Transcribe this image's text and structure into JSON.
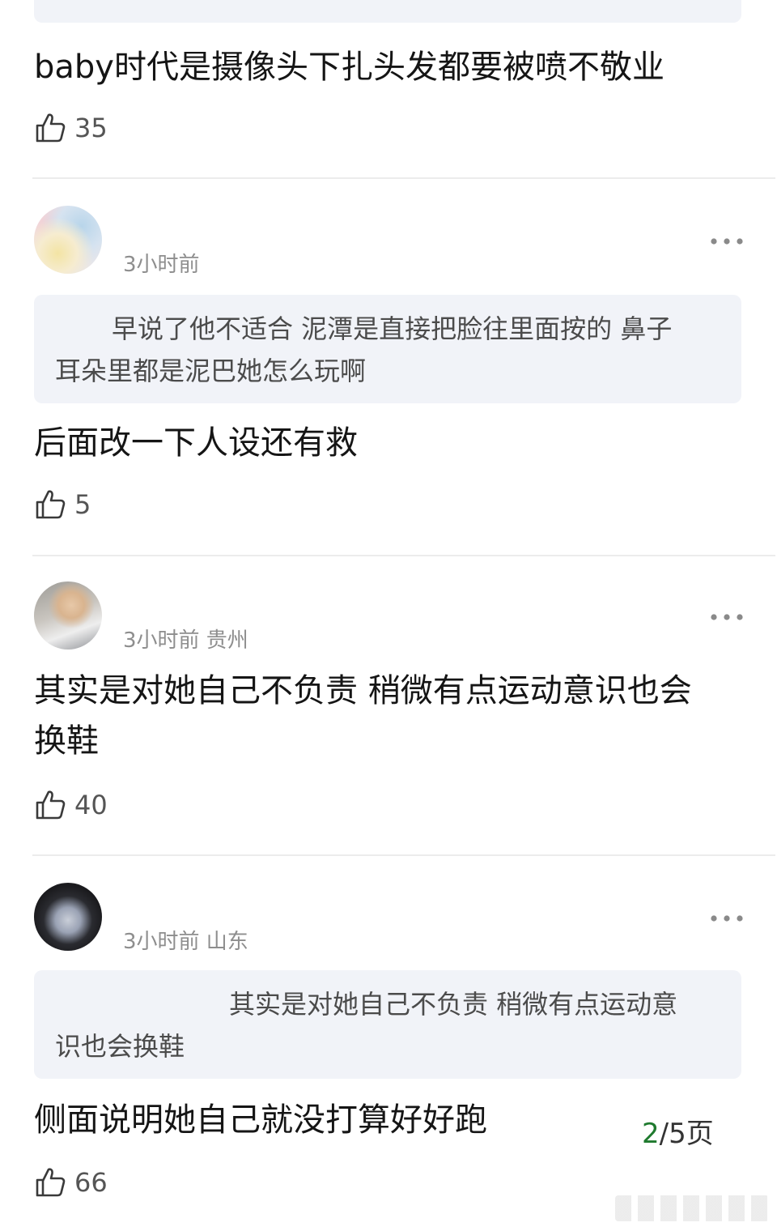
{
  "comments": [
    {
      "text": "baby时代是摄像头下扎头发都要被喷不敬业",
      "likes": "35"
    },
    {
      "meta": "3小时前",
      "quote_line1": "早说了他不适合 泥潭是直接把脸往里面按的 鼻子",
      "quote_line2": "耳朵里都是泥巴她怎么玩啊",
      "text": "后面改一下人设还有救",
      "likes": "5"
    },
    {
      "meta": "3小时前 贵州",
      "text": "其实是对她自己不负责 稍微有点运动意识也会\n换鞋",
      "likes": "40"
    },
    {
      "meta": "3小时前 山东",
      "quote_line1": "其实是对她自己不负责 稍微有点运动意",
      "quote_line2": "识也会换鞋",
      "text": "侧面说明她自己就没打算好好跑",
      "likes": "66"
    }
  ],
  "pagination": {
    "current": "2",
    "rest": "/5页"
  },
  "icons": {
    "like": "thumbs-up-icon",
    "more": "more-dots-icon"
  },
  "colors": {
    "page_current": "#1f7a2e",
    "quote_bg": "#f1f3f8",
    "meta": "#8e8e8e"
  }
}
